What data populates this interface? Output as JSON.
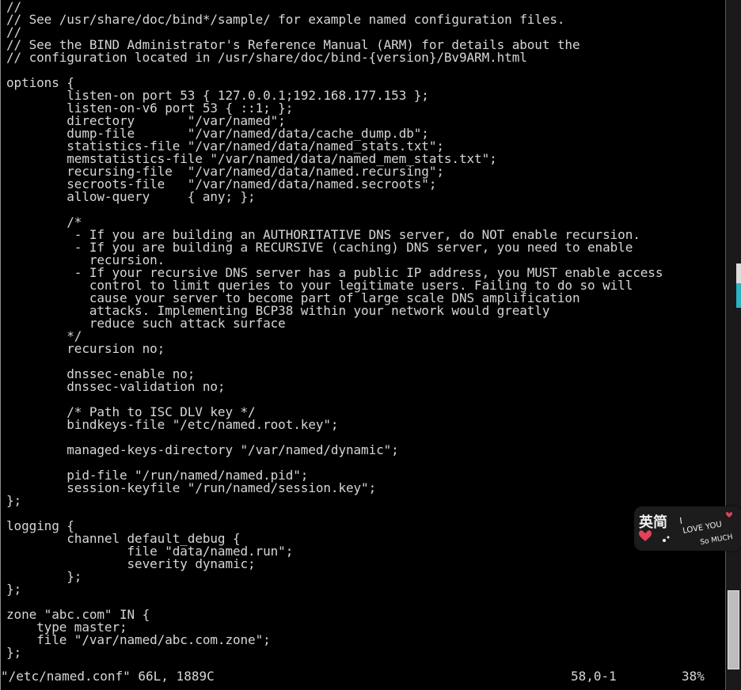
{
  "editor": {
    "lines": [
      "//",
      "// See /usr/share/doc/bind*/sample/ for example named configuration files.",
      "//",
      "// See the BIND Administrator's Reference Manual (ARM) for details about the",
      "// configuration located in /usr/share/doc/bind-{version}/Bv9ARM.html",
      "",
      "options {",
      "        listen-on port 53 { 127.0.0.1;192.168.177.153 };",
      "        listen-on-v6 port 53 { ::1; };",
      "        directory       \"/var/named\";",
      "        dump-file       \"/var/named/data/cache_dump.db\";",
      "        statistics-file \"/var/named/data/named_stats.txt\";",
      "        memstatistics-file \"/var/named/data/named_mem_stats.txt\";",
      "        recursing-file  \"/var/named/data/named.recursing\";",
      "        secroots-file   \"/var/named/data/named.secroots\";",
      "        allow-query     { any; };",
      "",
      "        /*",
      "         - If you are building an AUTHORITATIVE DNS server, do NOT enable recursion.",
      "         - If you are building a RECURSIVE (caching) DNS server, you need to enable",
      "           recursion.",
      "         - If your recursive DNS server has a public IP address, you MUST enable access",
      "           control to limit queries to your legitimate users. Failing to do so will",
      "           cause your server to become part of large scale DNS amplification",
      "           attacks. Implementing BCP38 within your network would greatly",
      "           reduce such attack surface",
      "        */",
      "        recursion no;",
      "",
      "        dnssec-enable no;",
      "        dnssec-validation no;",
      "",
      "        /* Path to ISC DLV key */",
      "        bindkeys-file \"/etc/named.root.key\";",
      "",
      "        managed-keys-directory \"/var/named/dynamic\";",
      "",
      "        pid-file \"/run/named/named.pid\";",
      "        session-keyfile \"/run/named/session.key\";",
      "};",
      "",
      "logging {",
      "        channel default_debug {",
      "                file \"data/named.run\";",
      "                severity dynamic;",
      "        };",
      "};",
      "",
      "zone \"abc.com\" IN {",
      "    type master;",
      "    file \"/var/named/abc.com.zone\";",
      "};",
      ""
    ],
    "status": {
      "file_info": "\"/etc/named.conf\" 66L, 1889C",
      "cursor_position": "58,0-1",
      "scroll_percent": "38%"
    }
  },
  "overlay_sticker": {
    "logo_text": "英简",
    "tagline": "I LOVE YOU So MUCH",
    "heart_color": "#e5415a"
  },
  "colors": {
    "background": "#000000",
    "foreground": "#d6d6d6",
    "scroll_accent": "#2bb3c0"
  }
}
